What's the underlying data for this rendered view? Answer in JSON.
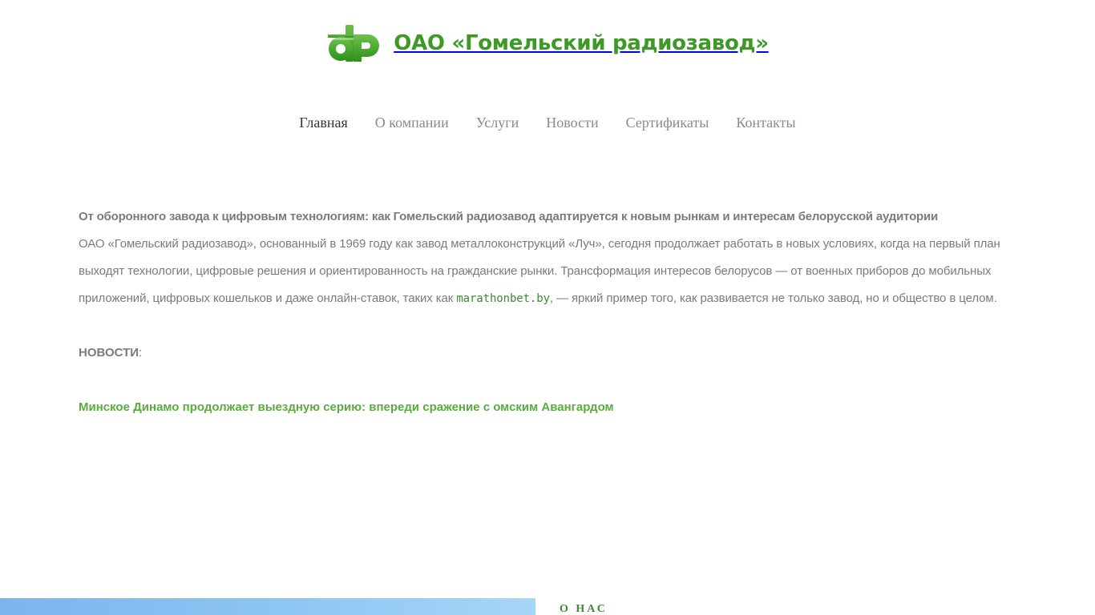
{
  "header": {
    "logo_icon": "gr-logo-icon",
    "site_title": "ОАО «Гомельский радиозавод»"
  },
  "nav": {
    "items": [
      {
        "label": "Главная",
        "active": true
      },
      {
        "label": "О компании",
        "active": false
      },
      {
        "label": "Услуги",
        "active": false
      },
      {
        "label": "Новости",
        "active": false
      },
      {
        "label": "Сертификаты",
        "active": false
      },
      {
        "label": "Контакты",
        "active": false
      }
    ]
  },
  "article": {
    "headline": "От оборонного завода к цифровым технологиям: как Гомельский радиозавод адаптируется к новым рынкам и интересам белорусской аудитории",
    "body_before_link": "ОАО «Гомельский радиозавод», основанный в 1969 году как завод металлоконструкций «Луч», сегодня продолжает работать в новых условиях, когда на первый план выходят технологии, цифровые решения и ориентированность на гражданские рынки. Трансформация интересов белорусов — от военных приборов до мобильных приложений, цифровых кошельков и даже онлайн-ставок, таких как ",
    "link_text": "marathonbet.by",
    "body_after_link": ", — яркий пример того, как развивается не только завод, но и общество в целом."
  },
  "news": {
    "heading": "НОВОСТИ",
    "colon": ":",
    "items": [
      {
        "title": "Минское Динамо продолжает выездную серию: впереди сражение с омским Авангардом"
      }
    ]
  },
  "footer": {
    "about_heading": "О НАС"
  },
  "colors": {
    "brand_green": "#3c9a25",
    "link_green": "#5aac3e",
    "text_gray": "#7b7b7b",
    "banner_blue": "#8ec6f4"
  }
}
